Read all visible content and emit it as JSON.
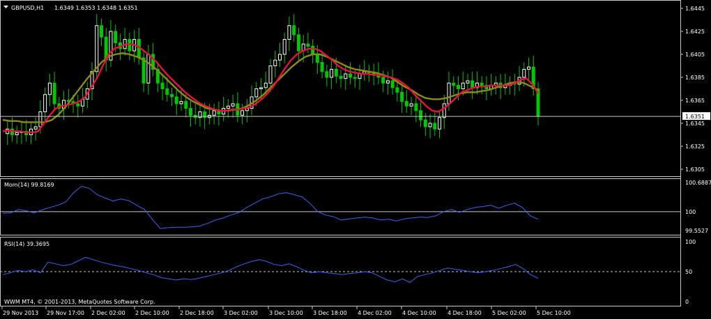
{
  "chart_data": [
    {
      "type": "line",
      "name": "main",
      "title": "GBPUSD,H1",
      "ohlc_header": "1.6349 1.6353 1.6348 1.6351",
      "current_price_label": "1.6351",
      "current_price": 1.6351,
      "ylim": [
        1.63,
        1.645
      ],
      "y_ticks": [
        "1.6445",
        "1.6425",
        "1.6405",
        "1.6385",
        "1.6365",
        "1.6345",
        "1.6325",
        "1.6305"
      ],
      "y_tick_values": [
        1.6445,
        1.6425,
        1.6405,
        1.6385,
        1.6365,
        1.6345,
        1.6325,
        1.6305
      ],
      "x_ticks": [
        "29 Nov 2013",
        "29 Nov 17:00",
        "2 Dec 02:00",
        "2 Dec 10:00",
        "2 Dec 18:00",
        "3 Dec 02:00",
        "3 Dec 10:00",
        "3 Dec 18:00",
        "4 Dec 02:00",
        "4 Dec 10:00",
        "4 Dec 18:00",
        "5 Dec 02:00",
        "5 Dec 10:00"
      ],
      "colors": {
        "bull": "#ffffff",
        "bear": "#00c800",
        "ma_fast": "#e8103c",
        "ma_slow": "#8c8c14",
        "price_line": "#c8c8c8"
      },
      "close_series": [
        1.6336,
        1.634,
        1.6335,
        1.6337,
        1.6338,
        1.6335,
        1.634,
        1.6342,
        1.6355,
        1.637,
        1.638,
        1.6362,
        1.6358,
        1.6365,
        1.6364,
        1.6362,
        1.636,
        1.6366,
        1.6375,
        1.639,
        1.643,
        1.642,
        1.64,
        1.6425,
        1.6415,
        1.641,
        1.6418,
        1.6408,
        1.6418,
        1.6402,
        1.638,
        1.6405,
        1.6392,
        1.638,
        1.6375,
        1.637,
        1.6368,
        1.6362,
        1.6364,
        1.6358,
        1.6352,
        1.635,
        1.6355,
        1.635,
        1.6352,
        1.6356,
        1.6353,
        1.6358,
        1.636,
        1.6362,
        1.6352,
        1.6356,
        1.6358,
        1.6368,
        1.6375,
        1.6376,
        1.638,
        1.6395,
        1.64,
        1.6405,
        1.6418,
        1.643,
        1.6422,
        1.6408,
        1.6414,
        1.6412,
        1.6405,
        1.6398,
        1.639,
        1.6385,
        1.6392,
        1.6386,
        1.6384,
        1.6388,
        1.6385,
        1.6384,
        1.6388,
        1.639,
        1.6389,
        1.6388,
        1.6385,
        1.638,
        1.6382,
        1.6376,
        1.6372,
        1.6364,
        1.636,
        1.6362,
        1.6356,
        1.6348,
        1.6342,
        1.6345,
        1.634,
        1.635,
        1.6362,
        1.638,
        1.6378,
        1.6375,
        1.638,
        1.6382,
        1.6376,
        1.638,
        1.6378,
        1.6375,
        1.6378,
        1.638,
        1.6376,
        1.6378,
        1.638,
        1.6379,
        1.6385,
        1.6392,
        1.6394,
        1.6375,
        1.6351
      ],
      "ma_fast_series": [
        1.6338,
        1.6339,
        1.6338,
        1.6338,
        1.6337,
        1.6337,
        1.6338,
        1.6345,
        1.6352,
        1.6358,
        1.636,
        1.6361,
        1.6362,
        1.6364,
        1.6368,
        1.6376,
        1.6384,
        1.6395,
        1.6405,
        1.641,
        1.6412,
        1.6414,
        1.6414,
        1.6412,
        1.6408,
        1.6404,
        1.6399,
        1.6393,
        1.6387,
        1.6382,
        1.6377,
        1.6372,
        1.6368,
        1.6364,
        1.6361,
        1.6359,
        1.6357,
        1.6356,
        1.6356,
        1.6357,
        1.6357,
        1.6358,
        1.6359,
        1.6362,
        1.6366,
        1.6371,
        1.6377,
        1.6385,
        1.6393,
        1.64,
        1.6405,
        1.6408,
        1.641,
        1.641,
        1.6408,
        1.6404,
        1.64,
        1.6395,
        1.6392,
        1.639,
        1.6389,
        1.6388,
        1.6388,
        1.6387,
        1.6387,
        1.6386,
        1.6385,
        1.6383,
        1.638,
        1.6376,
        1.637,
        1.6365,
        1.636,
        1.6356,
        1.6355,
        1.6358,
        1.6362,
        1.6367,
        1.6372,
        1.6374,
        1.6376,
        1.6377,
        1.6377,
        1.6378,
        1.6378,
        1.6378,
        1.6378,
        1.638,
        1.6383,
        1.6384,
        1.6379,
        1.6371
      ],
      "ma_slow_series": [
        1.6348,
        1.6347,
        1.6347,
        1.6346,
        1.6346,
        1.6346,
        1.6346,
        1.6348,
        1.6353,
        1.636,
        1.6368,
        1.6376,
        1.6384,
        1.6391,
        1.6398,
        1.6403,
        1.6405,
        1.6406,
        1.6405,
        1.6403,
        1.64,
        1.6396,
        1.6391,
        1.6385,
        1.6379,
        1.6373,
        1.6368,
        1.6364,
        1.6361,
        1.6358,
        1.6357,
        1.6356,
        1.6356,
        1.6357,
        1.6358,
        1.6361,
        1.6365,
        1.637,
        1.6376,
        1.6382,
        1.6388,
        1.6394,
        1.6399,
        1.6403,
        1.6405,
        1.6405,
        1.6403,
        1.64,
        1.6397,
        1.6394,
        1.6392,
        1.6391,
        1.639,
        1.6389,
        1.6387,
        1.6385,
        1.6381,
        1.6377,
        1.6374,
        1.637,
        1.6367,
        1.6366,
        1.6366,
        1.6367,
        1.6369,
        1.6371,
        1.6372,
        1.6372,
        1.6373,
        1.6374,
        1.6376,
        1.6378,
        1.638,
        1.6381,
        1.638,
        1.6377,
        1.6374
      ]
    },
    {
      "type": "line",
      "name": "momentum",
      "title": "Mom(14) 99.8169",
      "ylim": [
        99.5527,
        100.6887
      ],
      "y_ticks": [
        "100.6887",
        "100",
        "99.5527"
      ],
      "y_tick_values": [
        100.6887,
        100.0,
        99.5527
      ],
      "reference_level": 100,
      "series_color": "#3c64f0",
      "values": [
        99.96,
        99.97,
        100.05,
        100.02,
        99.97,
        100.04,
        100.1,
        100.15,
        100.23,
        100.45,
        100.6,
        100.55,
        100.4,
        100.32,
        100.25,
        100.3,
        100.26,
        100.15,
        100.05,
        99.82,
        99.6,
        99.62,
        99.63,
        99.63,
        99.64,
        99.66,
        99.72,
        99.8,
        99.85,
        99.92,
        99.98,
        100.1,
        100.2,
        100.3,
        100.35,
        100.42,
        100.45,
        100.4,
        100.35,
        100.2,
        100.0,
        99.92,
        99.88,
        99.8,
        99.83,
        99.85,
        99.87,
        99.85,
        99.8,
        99.82,
        99.78,
        99.83,
        99.85,
        99.87,
        99.86,
        99.9,
        100.0,
        100.05,
        99.98,
        100.05,
        100.1,
        100.12,
        100.15,
        100.08,
        100.15,
        100.2,
        100.1,
        99.9,
        99.82
      ]
    },
    {
      "type": "line",
      "name": "rsi",
      "title": "RSI(14) 39.3695",
      "ylim": [
        0,
        100
      ],
      "y_ticks": [
        "100",
        "50",
        "0"
      ],
      "y_tick_values": [
        100,
        50,
        0
      ],
      "reference_level": 50,
      "series_color": "#3c64f0",
      "values": [
        45,
        48,
        52,
        50,
        53,
        48,
        66,
        63,
        60,
        62,
        68,
        74,
        70,
        66,
        63,
        60,
        58,
        55,
        52,
        48,
        45,
        40,
        38,
        36,
        38,
        37,
        39,
        42,
        45,
        48,
        52,
        58,
        63,
        67,
        70,
        67,
        62,
        60,
        63,
        58,
        52,
        48,
        50,
        48,
        47,
        45,
        47,
        48,
        50,
        48,
        42,
        36,
        33,
        38,
        32,
        42,
        45,
        48,
        52,
        56,
        54,
        52,
        50,
        48,
        50,
        52,
        55,
        58,
        62,
        55,
        45,
        39
      ]
    }
  ],
  "footer": {
    "copyright": "WWM MT4, © 2001-2013, MetaQuotes Software Corp."
  }
}
